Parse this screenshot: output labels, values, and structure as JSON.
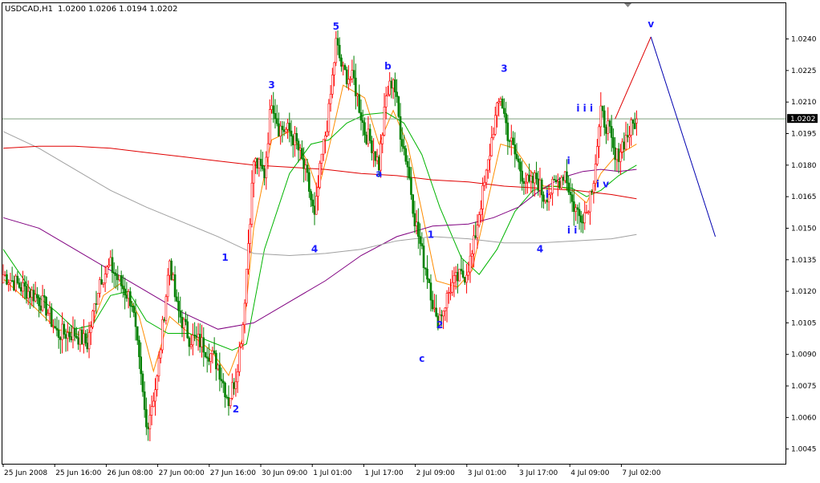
{
  "header": {
    "symbol_label": "USDCAD,H1",
    "ohlc_label": "1.0200 1.0206 1.0194 1.0202"
  },
  "price_tag": "1.0202",
  "colors": {
    "background": "#ffffff",
    "bull": "#ff0000",
    "bear": "#008000",
    "ma_fast": "#ff8c00",
    "ma_mid": "#00b400",
    "ma_slow": "#800080",
    "ma_grey": "#a0a0a0",
    "ma_red": "#e00000",
    "wave_label": "#1a1aff",
    "projection_up": "#e00000",
    "projection_down": "#0000b0",
    "price_line": "#7f9f7f"
  },
  "chart_data": {
    "type": "candlestick",
    "symbol": "USDCAD",
    "timeframe": "H1",
    "y_ticks": [
      "1.0240",
      "1.0225",
      "1.0210",
      "1.0195",
      "1.0180",
      "1.0165",
      "1.0150",
      "1.0135",
      "1.0120",
      "1.0105",
      "1.0090",
      "1.0075",
      "1.0060",
      "1.0045"
    ],
    "ylim": [
      1.0038,
      1.0257
    ],
    "x_ticks": [
      "25 Jun 2008",
      "25 Jun 16:00",
      "26 Jun 08:00",
      "27 Jun 00:00",
      "27 Jun 16:00",
      "30 Jun 09:00",
      "1 Jul 01:00",
      "1 Jul 17:00",
      "2 Jul 09:00",
      "3 Jul 01:00",
      "3 Jul 17:00",
      "4 Jul 09:00",
      "7 Jul 02:00"
    ],
    "bars_per_tick": 16,
    "current_price": 1.0202,
    "last_bar": {
      "open": 1.02,
      "high": 1.0206,
      "low": 1.0194,
      "close": 1.0202
    },
    "close_anchors": [
      [
        0,
        1.0128
      ],
      [
        10,
        1.0122
      ],
      [
        18,
        1.0118
      ],
      [
        24,
        1.0112
      ],
      [
        30,
        1.01
      ],
      [
        40,
        1.01
      ],
      [
        47,
        1.0095
      ],
      [
        54,
        1.0126
      ],
      [
        60,
        1.0132
      ],
      [
        66,
        1.0123
      ],
      [
        72,
        1.0115
      ],
      [
        80,
        1.0055
      ],
      [
        86,
        1.0078
      ],
      [
        93,
        1.0135
      ],
      [
        97,
        1.0112
      ],
      [
        104,
        1.0098
      ],
      [
        110,
        1.0096
      ],
      [
        116,
        1.009
      ],
      [
        120,
        1.0085
      ],
      [
        126,
        1.0068
      ],
      [
        130,
        1.008
      ],
      [
        134,
        1.0105
      ],
      [
        140,
        1.0182
      ],
      [
        146,
        1.0176
      ],
      [
        150,
        1.0212
      ],
      [
        154,
        1.0198
      ],
      [
        160,
        1.0196
      ],
      [
        164,
        1.019
      ],
      [
        170,
        1.0173
      ],
      [
        174,
        1.0154
      ],
      [
        178,
        1.0184
      ],
      [
        182,
        1.0205
      ],
      [
        186,
        1.0238
      ],
      [
        190,
        1.0224
      ],
      [
        196,
        1.022
      ],
      [
        202,
        1.0196
      ],
      [
        206,
        1.019
      ],
      [
        210,
        1.018
      ],
      [
        214,
        1.0212
      ],
      [
        218,
        1.0222
      ],
      [
        222,
        1.0196
      ],
      [
        226,
        1.018
      ],
      [
        230,
        1.0155
      ],
      [
        234,
        1.0138
      ],
      [
        238,
        1.0125
      ],
      [
        242,
        1.0105
      ],
      [
        246,
        1.0112
      ],
      [
        250,
        1.0122
      ],
      [
        254,
        1.0126
      ],
      [
        258,
        1.0128
      ],
      [
        262,
        1.0137
      ],
      [
        266,
        1.0158
      ],
      [
        270,
        1.0175
      ],
      [
        274,
        1.0198
      ],
      [
        278,
        1.0213
      ],
      [
        282,
        1.0195
      ],
      [
        286,
        1.0185
      ],
      [
        290,
        1.0176
      ],
      [
        294,
        1.017
      ],
      [
        298,
        1.0174
      ],
      [
        302,
        1.0165
      ],
      [
        306,
        1.0168
      ],
      [
        310,
        1.0172
      ],
      [
        314,
        1.0177
      ],
      [
        318,
        1.0162
      ],
      [
        322,
        1.0156
      ],
      [
        326,
        1.0158
      ],
      [
        330,
        1.0175
      ],
      [
        334,
        1.0204
      ],
      [
        338,
        1.0198
      ],
      [
        342,
        1.0182
      ],
      [
        346,
        1.019
      ],
      [
        350,
        1.0196
      ],
      [
        354,
        1.0202
      ]
    ],
    "moving_averages": [
      {
        "color": "ma_fast",
        "anchors": [
          [
            0,
            1.0126
          ],
          [
            18,
            1.0112
          ],
          [
            30,
            1.0102
          ],
          [
            40,
            1.01
          ],
          [
            47,
            1.0098
          ],
          [
            56,
            1.0118
          ],
          [
            66,
            1.0124
          ],
          [
            76,
            1.0108
          ],
          [
            84,
            1.0082
          ],
          [
            93,
            1.0108
          ],
          [
            104,
            1.01
          ],
          [
            116,
            1.0092
          ],
          [
            126,
            1.008
          ],
          [
            134,
            1.0098
          ],
          [
            140,
            1.015
          ],
          [
            150,
            1.0192
          ],
          [
            160,
            1.0196
          ],
          [
            170,
            1.0182
          ],
          [
            176,
            1.0168
          ],
          [
            182,
            1.0188
          ],
          [
            190,
            1.0218
          ],
          [
            202,
            1.0212
          ],
          [
            210,
            1.019
          ],
          [
            218,
            1.0206
          ],
          [
            226,
            1.019
          ],
          [
            234,
            1.0158
          ],
          [
            242,
            1.0125
          ],
          [
            254,
            1.0122
          ],
          [
            262,
            1.013
          ],
          [
            270,
            1.016
          ],
          [
            278,
            1.019
          ],
          [
            286,
            1.0188
          ],
          [
            294,
            1.0178
          ],
          [
            302,
            1.017
          ],
          [
            310,
            1.017
          ],
          [
            318,
            1.0168
          ],
          [
            326,
            1.0162
          ],
          [
            334,
            1.0176
          ],
          [
            342,
            1.0184
          ],
          [
            354,
            1.019
          ]
        ]
      },
      {
        "color": "ma_mid",
        "anchors": [
          [
            0,
            1.014
          ],
          [
            16,
            1.012
          ],
          [
            30,
            1.011
          ],
          [
            40,
            1.0102
          ],
          [
            50,
            1.0104
          ],
          [
            60,
            1.0118
          ],
          [
            70,
            1.012
          ],
          [
            80,
            1.0106
          ],
          [
            92,
            1.01
          ],
          [
            104,
            1.01
          ],
          [
            116,
            1.0096
          ],
          [
            128,
            1.0092
          ],
          [
            136,
            1.0095
          ],
          [
            146,
            1.014
          ],
          [
            160,
            1.0176
          ],
          [
            172,
            1.019
          ],
          [
            182,
            1.0192
          ],
          [
            192,
            1.02
          ],
          [
            202,
            1.0204
          ],
          [
            214,
            1.0205
          ],
          [
            224,
            1.02
          ],
          [
            234,
            1.0185
          ],
          [
            244,
            1.016
          ],
          [
            256,
            1.0136
          ],
          [
            266,
            1.0128
          ],
          [
            276,
            1.014
          ],
          [
            286,
            1.0158
          ],
          [
            296,
            1.0168
          ],
          [
            306,
            1.017
          ],
          [
            318,
            1.0169
          ],
          [
            326,
            1.0165
          ],
          [
            334,
            1.0168
          ],
          [
            344,
            1.0175
          ],
          [
            354,
            1.018
          ]
        ]
      },
      {
        "color": "ma_slow",
        "anchors": [
          [
            0,
            1.0155
          ],
          [
            20,
            1.015
          ],
          [
            40,
            1.014
          ],
          [
            60,
            1.013
          ],
          [
            80,
            1.012
          ],
          [
            100,
            1.011
          ],
          [
            120,
            1.0102
          ],
          [
            140,
            1.0105
          ],
          [
            160,
            1.0115
          ],
          [
            180,
            1.0125
          ],
          [
            200,
            1.0137
          ],
          [
            220,
            1.0146
          ],
          [
            240,
            1.0151
          ],
          [
            260,
            1.0152
          ],
          [
            274,
            1.0155
          ],
          [
            288,
            1.016
          ],
          [
            300,
            1.0168
          ],
          [
            312,
            1.0174
          ],
          [
            324,
            1.0177
          ],
          [
            334,
            1.0178
          ],
          [
            344,
            1.0177
          ],
          [
            354,
            1.0178
          ]
        ]
      },
      {
        "color": "ma_grey",
        "anchors": [
          [
            0,
            1.0196
          ],
          [
            20,
            1.0188
          ],
          [
            40,
            1.0178
          ],
          [
            60,
            1.0168
          ],
          [
            80,
            1.016
          ],
          [
            100,
            1.0153
          ],
          [
            120,
            1.0146
          ],
          [
            140,
            1.0138
          ],
          [
            160,
            1.0137
          ],
          [
            180,
            1.0138
          ],
          [
            200,
            1.014
          ],
          [
            220,
            1.0144
          ],
          [
            240,
            1.0146
          ],
          [
            260,
            1.0145
          ],
          [
            280,
            1.0143
          ],
          [
            300,
            1.0143
          ],
          [
            320,
            1.0144
          ],
          [
            340,
            1.0145
          ],
          [
            354,
            1.0147
          ]
        ]
      },
      {
        "color": "ma_red",
        "anchors": [
          [
            0,
            1.0188
          ],
          [
            20,
            1.0189
          ],
          [
            40,
            1.0189
          ],
          [
            60,
            1.0188
          ],
          [
            80,
            1.0186
          ],
          [
            100,
            1.0184
          ],
          [
            120,
            1.0182
          ],
          [
            140,
            1.018
          ],
          [
            160,
            1.0179
          ],
          [
            180,
            1.0178
          ],
          [
            200,
            1.0176
          ],
          [
            220,
            1.0175
          ],
          [
            240,
            1.0173
          ],
          [
            260,
            1.0172
          ],
          [
            280,
            1.017
          ],
          [
            300,
            1.0169
          ],
          [
            320,
            1.0168
          ],
          [
            340,
            1.0166
          ],
          [
            354,
            1.0164
          ]
        ]
      }
    ],
    "wave_labels": [
      {
        "text": "1",
        "bar": 124,
        "price": 1.0136,
        "pos": "above"
      },
      {
        "text": "2",
        "bar": 130,
        "price": 1.0064,
        "pos": "below"
      },
      {
        "text": "3",
        "bar": 150,
        "price": 1.0218,
        "pos": "above"
      },
      {
        "text": "4",
        "bar": 174,
        "price": 1.014,
        "pos": "below"
      },
      {
        "text": "5",
        "bar": 186,
        "price": 1.0246,
        "pos": "above"
      },
      {
        "text": "a",
        "bar": 210,
        "price": 1.0176,
        "pos": "below"
      },
      {
        "text": "b",
        "bar": 215,
        "price": 1.0227,
        "pos": "above"
      },
      {
        "text": "c",
        "bar": 234,
        "price": 1.0088,
        "pos": "below"
      },
      {
        "text": "1",
        "bar": 239,
        "price": 1.0147,
        "pos": "above"
      },
      {
        "text": "2",
        "bar": 244,
        "price": 1.0104,
        "pos": "below"
      },
      {
        "text": "3",
        "bar": 280,
        "price": 1.0226,
        "pos": "above"
      },
      {
        "text": "4",
        "bar": 300,
        "price": 1.014,
        "pos": "below"
      },
      {
        "text": "i",
        "bar": 304,
        "price": 1.0166,
        "pos": "above"
      },
      {
        "text": "i",
        "bar": 316,
        "price": 1.0182,
        "pos": "above"
      },
      {
        "text": "i i",
        "bar": 318,
        "price": 1.0149,
        "pos": "below"
      },
      {
        "text": "i i i",
        "bar": 325,
        "price": 1.0207,
        "pos": "above"
      },
      {
        "text": "i v",
        "bar": 335,
        "price": 1.0171,
        "pos": "below"
      },
      {
        "text": "v",
        "bar": 362,
        "price": 1.0247,
        "pos": "above"
      }
    ],
    "projection": [
      {
        "bar": 342,
        "price": 1.0202
      },
      {
        "bar": 362,
        "price": 1.0241
      },
      {
        "bar": 398,
        "price": 1.0146
      }
    ]
  }
}
